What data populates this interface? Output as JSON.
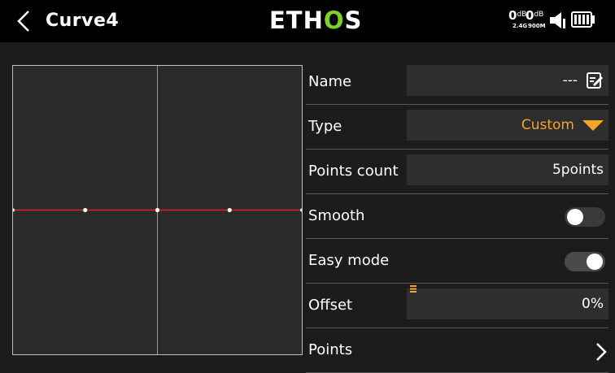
{
  "header": {
    "back_label": "<",
    "title": "Curve4",
    "logo_prefix": "ETH",
    "logo_accent": "O",
    "logo_suffix": "S",
    "rssi_24_value": "0",
    "rssi_24_unit": "dB",
    "rssi_24_band": "2.4G",
    "rssi_900_value": "0",
    "rssi_900_unit": "dB",
    "rssi_900_band": "900M"
  },
  "colors": {
    "accent_orange": "#f5a623",
    "logo_green": "#7ed321",
    "curve_red": "#e02020"
  },
  "curve": {
    "points_count": 5,
    "y_values": [
      0,
      0,
      0,
      0,
      0
    ]
  },
  "settings": {
    "name_label": "Name",
    "name_value": "---",
    "type_label": "Type",
    "type_value": "Custom",
    "points_count_label": "Points count",
    "points_count_value": "5points",
    "smooth_label": "Smooth",
    "smooth_on": false,
    "easy_mode_label": "Easy mode",
    "easy_mode_on": true,
    "offset_label": "Offset",
    "offset_value": "0%",
    "points_label": "Points"
  },
  "icons": {
    "back": "chevron-left-icon",
    "edit": "edit-icon",
    "dropdown": "triangle-down-icon",
    "speaker": "speaker-icon",
    "battery": "battery-icon",
    "next": "chevron-right-icon"
  }
}
